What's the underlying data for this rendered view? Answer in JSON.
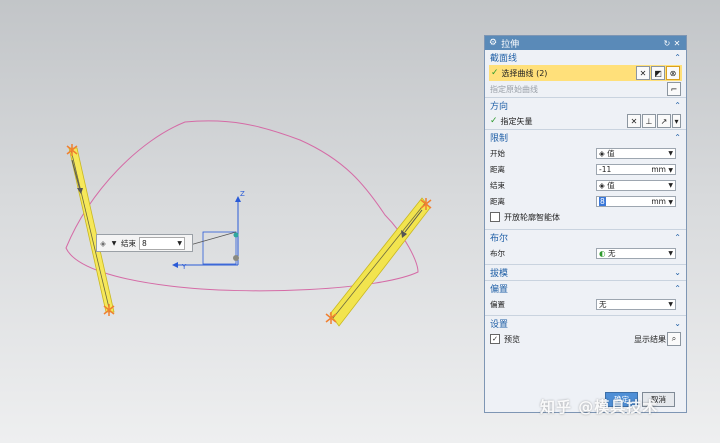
{
  "canvas": {
    "float_input": {
      "label": "结束",
      "value": "8"
    },
    "axes": {
      "y": "Y",
      "z": "Z"
    }
  },
  "dialog": {
    "title": "拉伸",
    "sections": {
      "section_curve": {
        "title": "截面线",
        "select_curve": "选择曲线 (2)",
        "specify_origin": "指定原始曲线"
      },
      "direction": {
        "title": "方向",
        "specify_vector": "指定矢量"
      },
      "limits": {
        "title": "限制",
        "start_label": "开始",
        "start_value": "值",
        "start_dist_label": "距离",
        "start_dist_value": "-11",
        "start_unit": "mm",
        "end_label": "结束",
        "end_value": "值",
        "end_dist_label": "距离",
        "end_dist_value": "8",
        "end_unit": "mm",
        "open_profile": "开放轮廓智能体"
      },
      "boolean": {
        "title": "布尔",
        "label": "布尔",
        "value": "无"
      },
      "draft": {
        "title": "拔模"
      },
      "offset": {
        "title": "偏置",
        "label": "偏置",
        "value": "无"
      },
      "settings": {
        "title": "设置"
      }
    },
    "preview_label": "预览",
    "show_result": "显示结果",
    "ok": "确定",
    "cancel": "取消"
  },
  "watermark": "知乎 @模具技术"
}
